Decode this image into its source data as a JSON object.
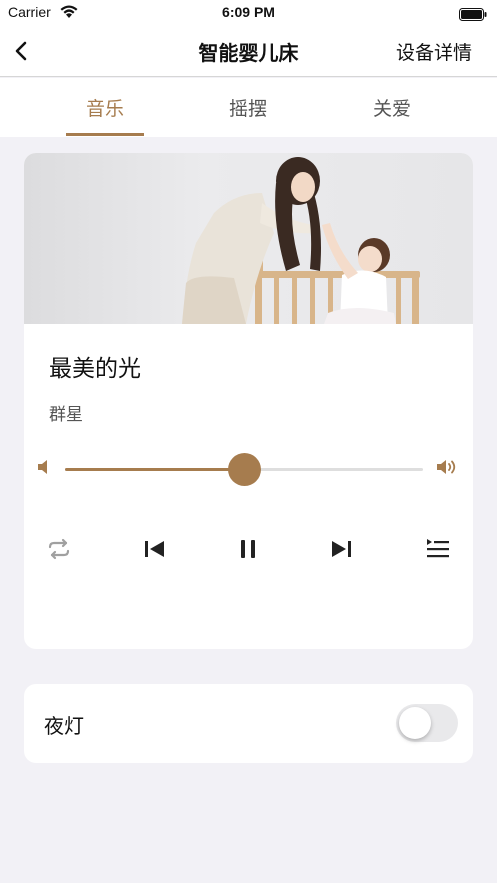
{
  "status_bar": {
    "carrier": "Carrier",
    "time": "6:09 PM"
  },
  "nav": {
    "title": "智能婴儿床",
    "detail_label": "设备详情",
    "back_icon": "chevron-left-icon"
  },
  "tabs": [
    {
      "label": "音乐",
      "active": true
    },
    {
      "label": "摇摆",
      "active": false
    },
    {
      "label": "关爱",
      "active": false
    }
  ],
  "player": {
    "song_title": "最美的光",
    "artist": "群星",
    "volume": 0.5,
    "controls": [
      "repeat-icon",
      "previous-icon",
      "pause-icon",
      "next-icon",
      "playlist-icon"
    ]
  },
  "night_light": {
    "label": "夜灯",
    "on": false
  },
  "colors": {
    "accent": "#a67c4e",
    "background": "#f2f1f6",
    "card": "#ffffff"
  }
}
